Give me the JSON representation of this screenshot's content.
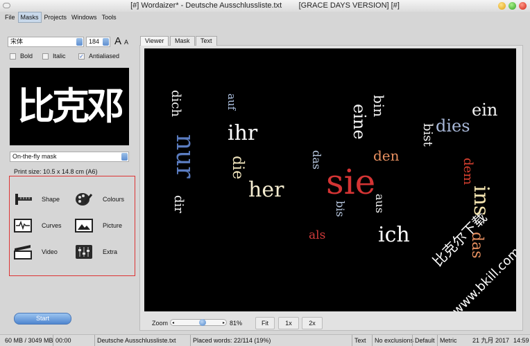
{
  "window": {
    "title": "[#] Wordaizer* - Deutsche Ausschlussliste.txt        [GRACE DAYS VERSION] [#]"
  },
  "menu": [
    "File",
    "Masks",
    "Projects",
    "Windows",
    "Tools"
  ],
  "font": {
    "family": "宋体",
    "size": "184",
    "grow": "A",
    "shrink": "A"
  },
  "options": {
    "bold": "Bold",
    "italic": "Italic",
    "antialiased": "Antialiased",
    "antialiased_checked": true
  },
  "mask": {
    "preview_text": "比克邓",
    "selected": "On-the-fly mask",
    "print_size": "Print size: 10.5 x 14.8 cm (A6)"
  },
  "tools": [
    {
      "label": "Shape",
      "icon": "ruler-icon"
    },
    {
      "label": "Colours",
      "icon": "palette-icon"
    },
    {
      "label": "Curves",
      "icon": "waveform-icon"
    },
    {
      "label": "Picture",
      "icon": "picture-icon"
    },
    {
      "label": "Video",
      "icon": "clapperboard-icon"
    },
    {
      "label": "Extra",
      "icon": "sliders-icon"
    }
  ],
  "start_label": "Start",
  "tabs": [
    "Viewer",
    "Mask",
    "Text"
  ],
  "active_tab": "Viewer",
  "cloud": [
    {
      "t": "dich",
      "c": "#f2f2f2"
    },
    {
      "t": "nur",
      "c": "#5a7cc0"
    },
    {
      "t": "dir",
      "c": "#f2f2f2"
    },
    {
      "t": "auf",
      "c": "#b0c4e4"
    },
    {
      "t": "ihr",
      "c": "#ffffff"
    },
    {
      "t": "die",
      "c": "#f0e4bc"
    },
    {
      "t": "her",
      "c": "#f4ecd0"
    },
    {
      "t": "das",
      "c": "#b8c8e0"
    },
    {
      "t": "sie",
      "c": "#d43434"
    },
    {
      "t": "bis",
      "c": "#b8c8e0"
    },
    {
      "t": "als",
      "c": "#d03a3a"
    },
    {
      "t": "eine",
      "c": "#f2f2f2"
    },
    {
      "t": "bin",
      "c": "#f2f2f2"
    },
    {
      "t": "den",
      "c": "#e89060"
    },
    {
      "t": "aus",
      "c": "#f2f2f2"
    },
    {
      "t": "ich",
      "c": "#ffffff"
    },
    {
      "t": "bist",
      "c": "#f2f2f2"
    },
    {
      "t": "dies",
      "c": "#a8b8d8"
    },
    {
      "t": "ein",
      "c": "#f2f2f2"
    },
    {
      "t": "dem",
      "c": "#d84030"
    },
    {
      "t": "ins",
      "c": "#f4e4b0"
    },
    {
      "t": "das",
      "c": "#e89060"
    }
  ],
  "watermark": [
    "比克尔下载",
    "www.bkill.com"
  ],
  "zoom": {
    "label": "Zoom",
    "value": "81%",
    "percent": 81,
    "fit": "Fit",
    "x1": "1x",
    "x2": "2x"
  },
  "status": {
    "memory": "60 MB / 3049 MB",
    "time": "00:00",
    "file": "Deutsche Ausschlussliste.txt",
    "placed": "Placed words: 22/114 (19%)",
    "mode": "Text",
    "exclusions": "No exclusions",
    "preset": "Default",
    "units": "Metric",
    "date": "21 九月 2017",
    "clock": "14:59"
  }
}
